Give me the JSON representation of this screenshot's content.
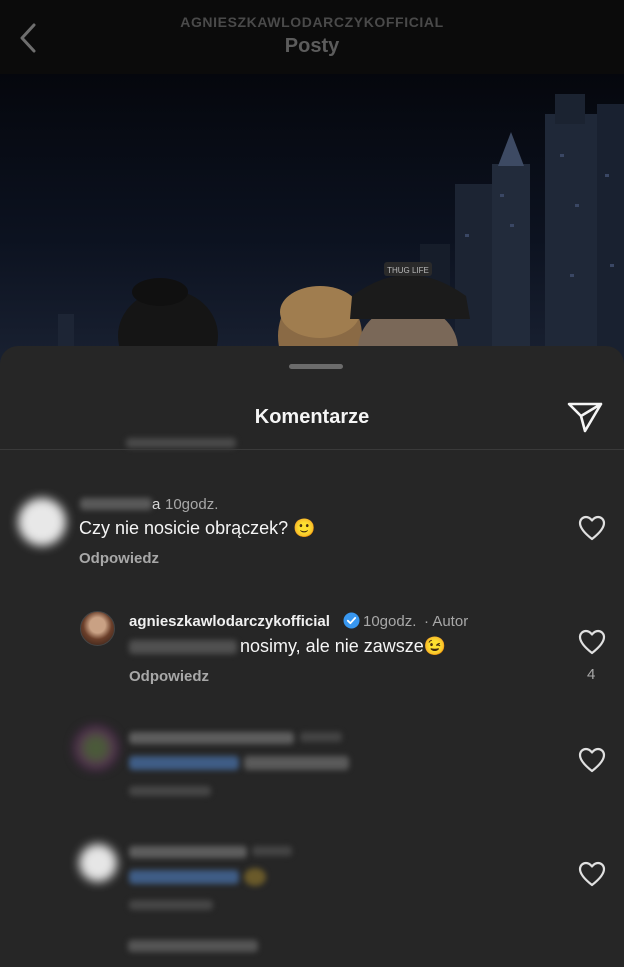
{
  "header": {
    "username": "AGNIESZKAWLODARCZYKOFFICIAL",
    "title": "Posty"
  },
  "photo": {
    "cap_text": "THUG LIFE"
  },
  "sheet": {
    "title": "Komentarze"
  },
  "comments": [
    {
      "username_tail": "a",
      "time": "10godz.",
      "text": "Czy nie nosicie obrączek? 🙂",
      "reply_label": "Odpowiedz"
    }
  ],
  "replies": [
    {
      "username": "agnieszkawlodarczykofficial",
      "time": "10godz.",
      "author_tag": "· Autor",
      "text": "nosimy, ale nie zawsze😉",
      "reply_label": "Odpowiedz",
      "likes": "4"
    }
  ],
  "colors": {
    "sheet_bg": "#262626",
    "verified": "#3897f0",
    "muted": "#a8a8a8"
  }
}
